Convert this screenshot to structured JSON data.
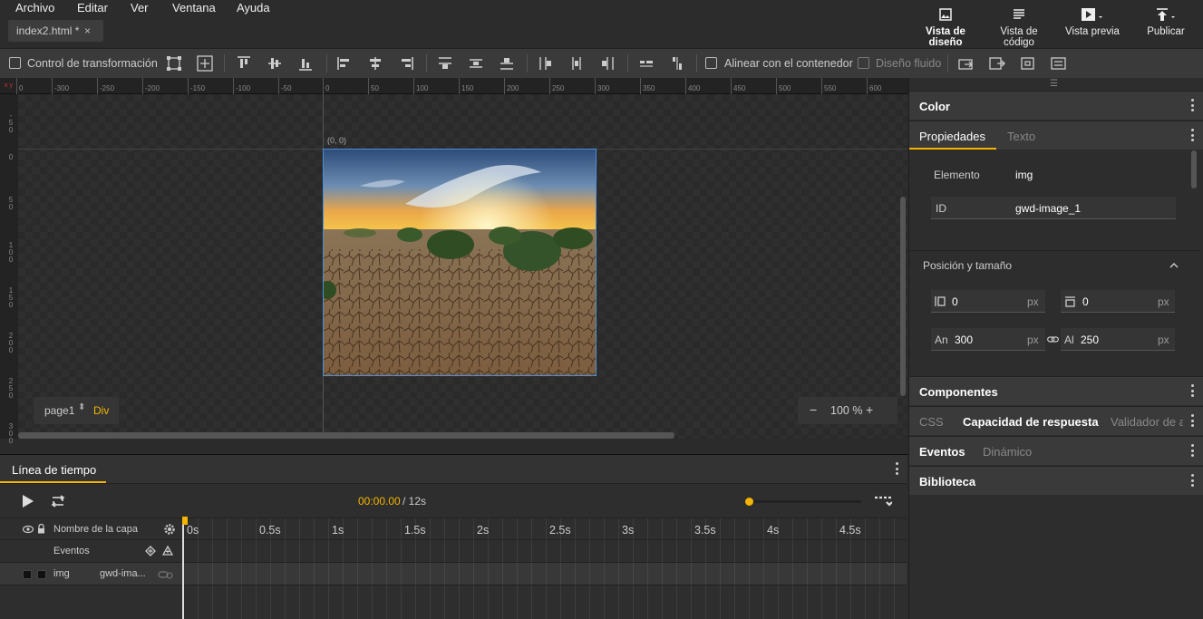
{
  "menu": {
    "items": [
      "Archivo",
      "Editar",
      "Ver",
      "Ventana",
      "Ayuda"
    ]
  },
  "file_tab": {
    "label": "index2.html *",
    "close": "×"
  },
  "view_buttons": {
    "design": "Vista de diseño",
    "code": "Vista de código",
    "preview": "Vista previa",
    "publish": "Publicar"
  },
  "toolbar": {
    "transform_label": "Control de transformación",
    "align_container_label": "Alinear con el contenedor",
    "fluid_label": "Diseño fluido"
  },
  "ruler": {
    "corner": "x y",
    "top_ticks": [
      "0",
      "-300",
      "-250",
      "-200",
      "-150",
      "-100",
      "-50",
      "0",
      "50",
      "100",
      "150",
      "200",
      "250",
      "300",
      "350",
      "400",
      "450",
      "500",
      "550",
      "600"
    ],
    "left_ticks": [
      "-50",
      "0",
      "50",
      "100",
      "150",
      "200",
      "250",
      "300"
    ]
  },
  "stage": {
    "origin_label": "(0, 0)",
    "page_selector": "page1",
    "page_type": "Div",
    "zoom_minus": "−",
    "zoom_value": "100 %",
    "zoom_plus": "+"
  },
  "timeline": {
    "tab_label": "Línea de tiempo",
    "current_time": "00:00.00",
    "total_time": "/ 12s",
    "layer_header": "Nombre de la capa",
    "events_label": "Eventos",
    "time_markers": [
      "0s",
      "0.5s",
      "1s",
      "1.5s",
      "2s",
      "2.5s",
      "3s",
      "3.5s",
      "4s",
      "4.5s"
    ],
    "layers": [
      {
        "type": "img",
        "id": "gwd-ima..."
      }
    ]
  },
  "right_panel": {
    "color_title": "Color",
    "tabs": [
      "Propiedades",
      "Texto"
    ],
    "element_label": "Elemento",
    "element_value": "img",
    "id_label": "ID",
    "id_value": "gwd-image_1",
    "position_section": "Posición y tamaño",
    "left_value": "0",
    "top_value": "0",
    "width_label": "An",
    "width_value": "300",
    "height_label": "Al",
    "height_value": "250",
    "unit": "px",
    "components_title": "Componentes",
    "css_tabs": [
      "CSS",
      "Capacidad de respuesta",
      "Validador de a"
    ],
    "events_tabs": [
      "Eventos",
      "Dinámico"
    ],
    "library_title": "Biblioteca"
  },
  "colors": {
    "accent": "#f5b400",
    "selection": "#4a90d9"
  }
}
